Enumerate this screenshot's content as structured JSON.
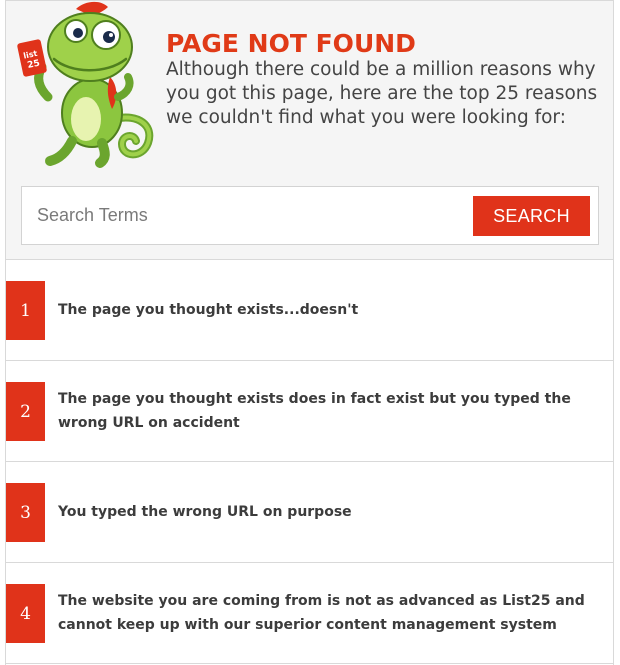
{
  "header": {
    "logo_badge": "list 25",
    "title": "PAGE NOT FOUND",
    "intro": "Although there could be a million reasons why you got this page, here are the top 25 reasons we couldn't find what you were looking for:"
  },
  "search": {
    "placeholder": "Search Terms",
    "button_label": "SEARCH"
  },
  "reasons": [
    {
      "number": "1",
      "text": "The page you thought exists...doesn't"
    },
    {
      "number": "2",
      "text": "The page you thought exists does in fact exist but you typed the wrong URL on accident"
    },
    {
      "number": "3",
      "text": "You typed the wrong URL on purpose"
    },
    {
      "number": "4",
      "text": "The website you are coming from is not as advanced as List25 and cannot keep up with our superior content management system"
    }
  ],
  "colors": {
    "accent": "#e0331a",
    "text": "#3c3c3c",
    "header_bg": "#f5f5f5",
    "mascot_green": "#8cc63f"
  }
}
